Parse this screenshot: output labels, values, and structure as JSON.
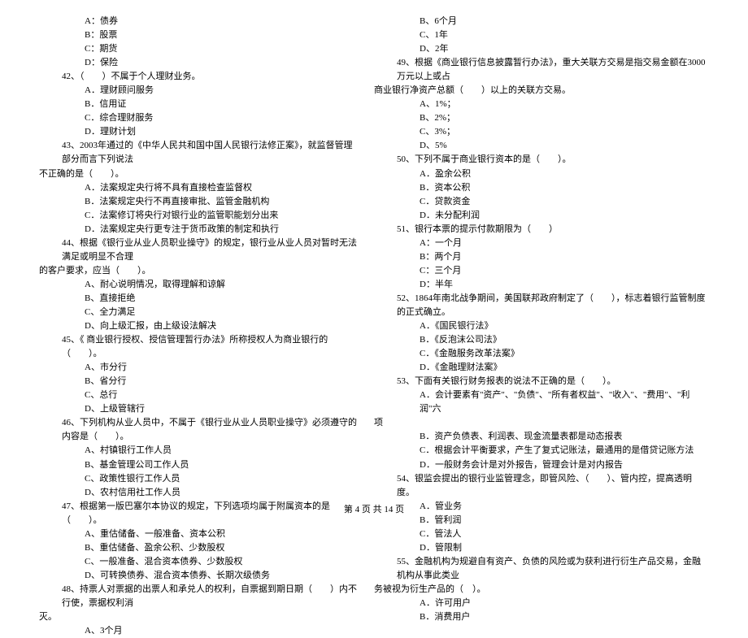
{
  "left": {
    "pre_opts": [
      "A：债券",
      "B：股票",
      "C：期货",
      "D：保险"
    ],
    "q42": "42、（　　）不属于个人理财业务。",
    "q42_opts": [
      "A．理财顾问服务",
      "B．信用证",
      "C．综合理财服务",
      "D．理财计划"
    ],
    "q43": "43、2003年通过的《中华人民共和国中国人民银行法修正案》，就监督管理部分而言下列说法",
    "q43b": "不正确的是（　　）。",
    "q43_opts": [
      "A．法案规定央行将不具有直接检查监督权",
      "B．法案规定央行不再直接审批、监管金融机构",
      "C．法案修订将央行对银行业的监管职能划分出来",
      "D．法案规定央行更专注于货币政策的制定和执行"
    ],
    "q44": "44、根据《银行业从业人员职业操守》的规定，银行业从业人员对暂时无法满足或明显不合理",
    "q44b": "的客户要求，应当（　　）。",
    "q44_opts": [
      "A、耐心说明情况，取得理解和谅解",
      "B、直接拒绝",
      "C、全力满足",
      "D、向上级汇报，由上级设法解决"
    ],
    "q45": "45、《 商业银行授权、授信管理暂行办法》所称授权人为商业银行的（　　）。",
    "q45_opts": [
      "A、市分行",
      "B、省分行",
      "C、总行",
      "D、上级管辖行"
    ],
    "q46": "46、下列机构从业人员中，不属于《银行业从业人员职业操守》必须遵守的内容是（　　）。",
    "q46_opts": [
      "A、村镇银行工作人员",
      "B、基金管理公司工作人员",
      "C、政策性银行工作人员",
      "D、农村信用社工作人员"
    ],
    "q47": "47、根据第一版巴塞尔本协议的规定，下列选项均属于附属资本的是（　　）。",
    "q47_opts": [
      "A、重估储备、一般准备、资本公积",
      "B、重估储备、盈余公积、少数股权",
      "C、一般准备、混合资本债券、少数股权",
      "D、可转换债券、混合资本债券、长期次级债务"
    ],
    "q48": "48、持票人对票据的出票人和承兑人的权利，自票据到期日期（　　）内不行使，票据权利消",
    "q48b": "灭。",
    "q48_opts": [
      "A、3个月"
    ]
  },
  "right": {
    "pre_opts": [
      "B、6个月",
      "C、1年",
      "D、2年"
    ],
    "q49": "49、根据《商业银行信息披露暂行办法》，重大关联方交易是指交易金额在3000万元以上或占",
    "q49b": "商业银行净资产总额（　　）以上的关联方交易。",
    "q49_opts": [
      "A、1%；",
      "B、2%；",
      "C、3%；",
      "D、5%"
    ],
    "q50": "50、下列不属于商业银行资本的是（　　）。",
    "q50_opts": [
      "A．盈余公积",
      "B．资本公积",
      "C．贷款资金",
      "D．未分配利润"
    ],
    "q51": "51、银行本票的提示付款期限为（　　）",
    "q51_opts": [
      "A：一个月",
      "B：两个月",
      "C：三个月",
      "D：半年"
    ],
    "q52": "52、1864年南北战争期间，美国联邦政府制定了（　　），标志着银行监管制度的正式确立。",
    "q52_opts": [
      "A．《国民银行法》",
      "B．《反泡沫公司法》",
      "C．《金融服务改革法案》",
      "D．《金融理财法案》"
    ],
    "q53": "53、下面有关银行财务报表的说法不正确的是（　　）。",
    "q53_opts": [
      "A．会计要素有\"资产\"、\"负债\"、\"所有者权益\"、\"收入\"、\"费用\"、\"利润\"六"
    ],
    "q53b": "项",
    "q53_opts2": [
      "B．资产负债表、利润表、现金流量表都是动态报表",
      "C．根据会计平衡要求，产生了复式记账法，最通用的是借贷记账方法",
      "D．一般财务会计是对外报告，管理会计是对内报告"
    ],
    "q54": "54、银监会提出的银行业监管理念，即管风险、（　　）、管内控，提高透明度。",
    "q54_opts": [
      "A．管业务",
      "B．管利润",
      "C．管法人",
      "D．管限制"
    ],
    "q55": "55、金融机构为规避自有资产、负债的风险或为获利进行衍生产品交易，金融机构从事此类业",
    "q55b": "务被视为衍生产品的（　）。",
    "q55_opts": [
      "A．许可用户",
      "B．消费用户"
    ]
  },
  "footer": "第 4 页 共 14 页"
}
